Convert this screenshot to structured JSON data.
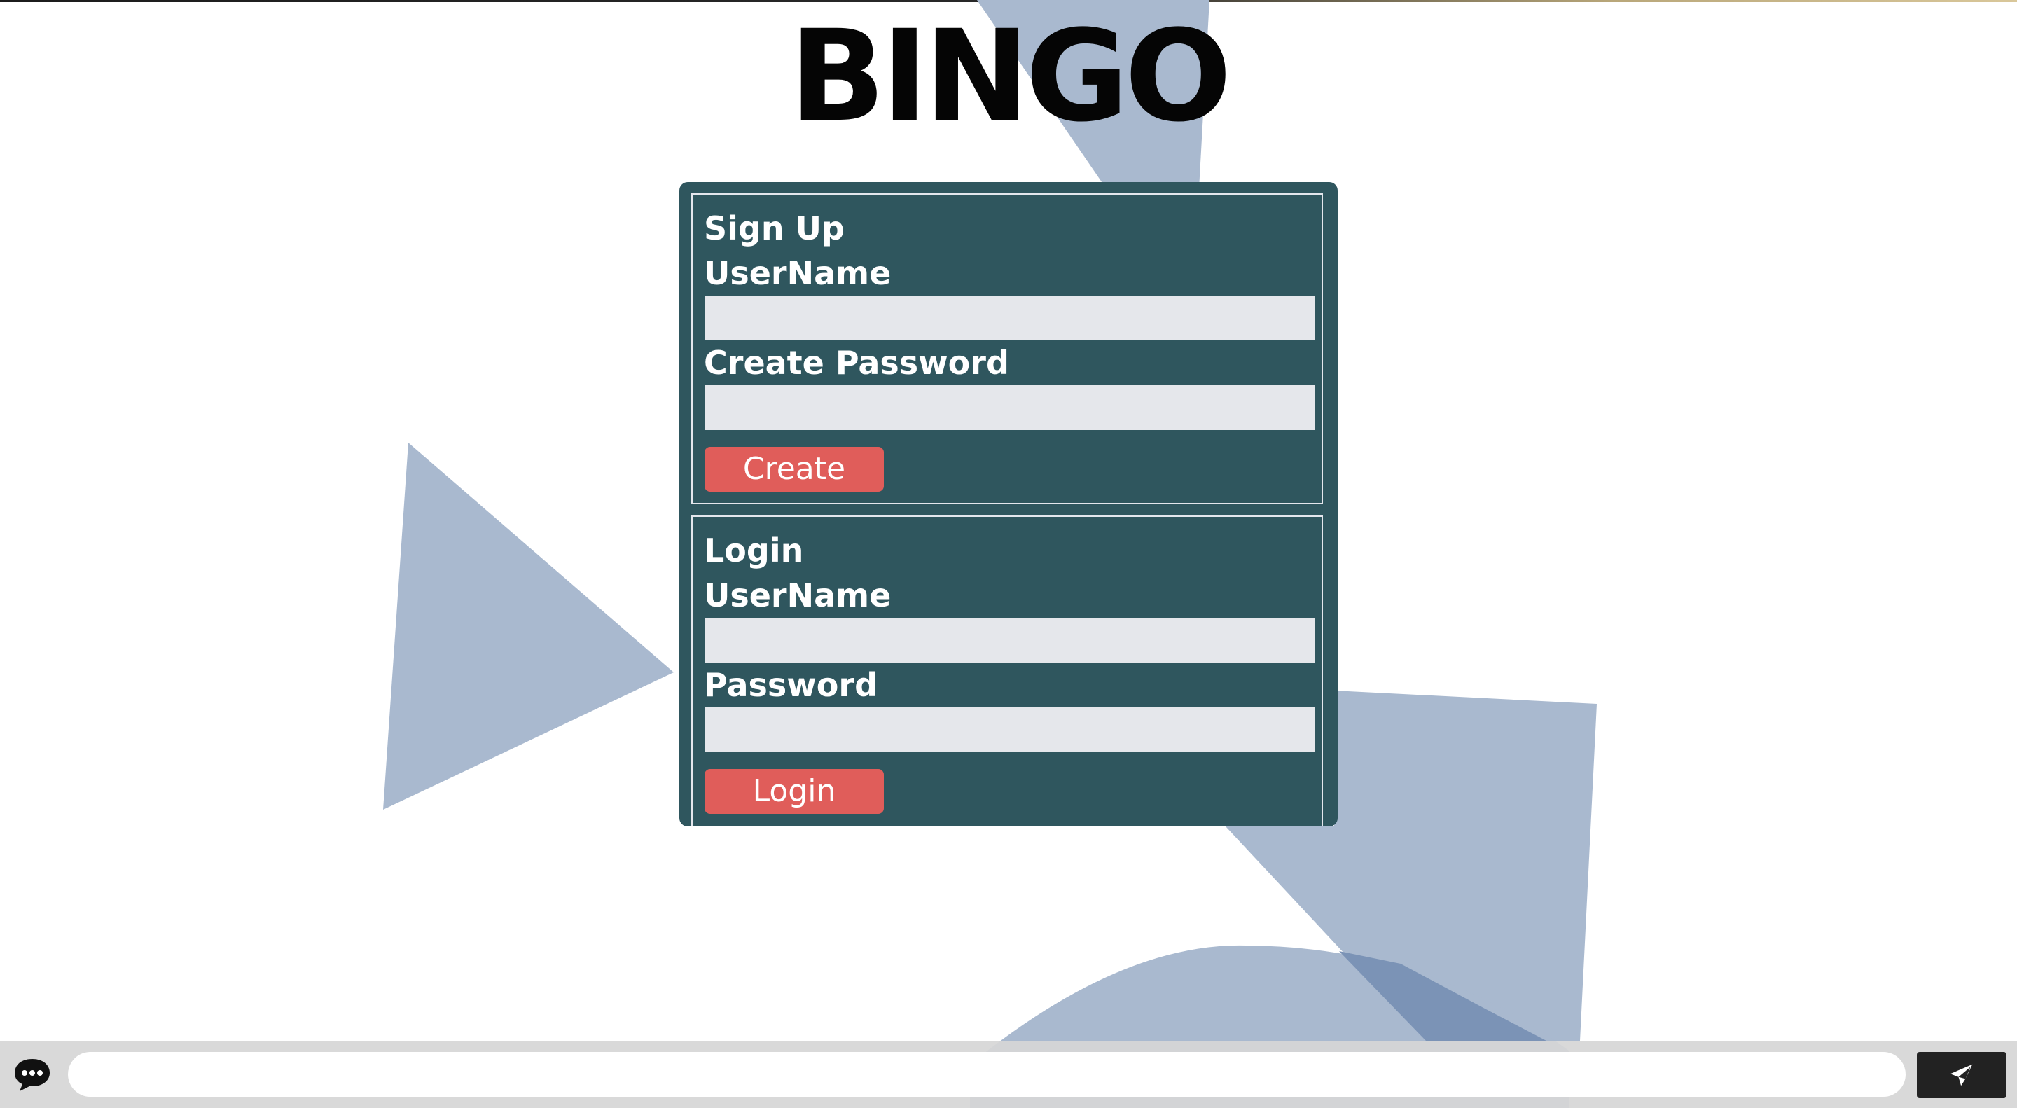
{
  "page": {
    "title": "BINGO"
  },
  "signup": {
    "heading": "Sign Up",
    "username_label": "UserName",
    "username_value": "",
    "password_label": "Create Password",
    "password_value": "",
    "button_label": "Create"
  },
  "login": {
    "heading": "Login",
    "username_label": "UserName",
    "username_value": "",
    "password_label": "Password",
    "password_value": "",
    "button_label": "Login"
  },
  "chat": {
    "icon": "speech-bubble-icon",
    "message_value": "",
    "send_icon": "paper-plane-icon"
  },
  "colors": {
    "panel_background": "#2f565e",
    "button_background": "#e05d5a",
    "input_background": "#e5e7eb",
    "background_shapes": "#a9b9cf",
    "chat_bar": "#d6d6d6",
    "send_button": "#222222"
  }
}
